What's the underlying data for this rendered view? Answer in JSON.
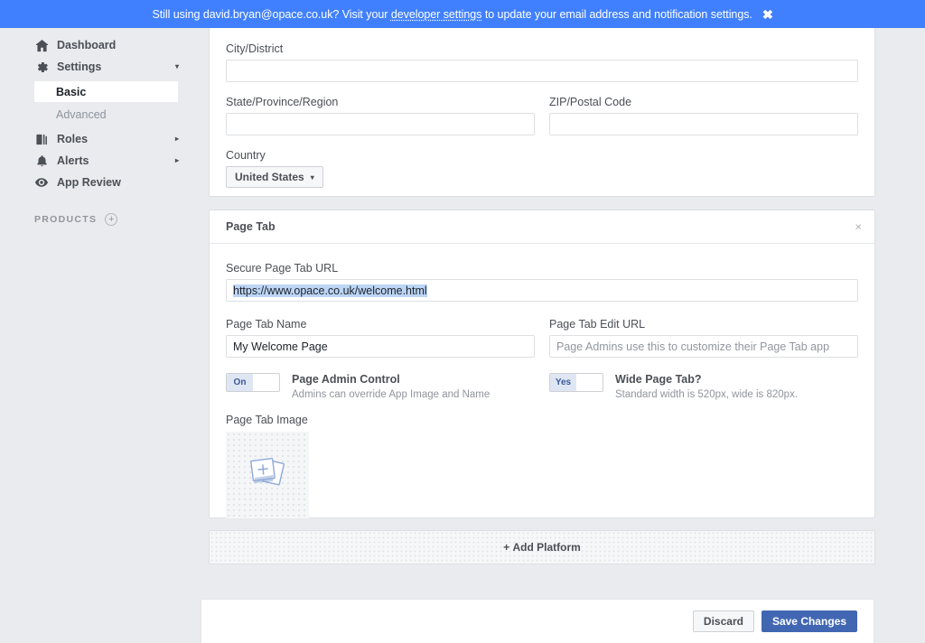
{
  "banner": {
    "text_before": "Still using david.bryan@opace.co.uk? Visit your ",
    "link": "developer settings",
    "text_after": " to update your email address and notification settings.",
    "close_icon": "close-icon",
    "bg_color": "#4080ff"
  },
  "sidebar": {
    "items": [
      {
        "label": "Dashboard",
        "icon": "home-icon",
        "caret": ""
      },
      {
        "label": "Settings",
        "icon": "gear-icon",
        "caret": "▾"
      },
      {
        "label": "Roles",
        "icon": "roles-icon",
        "caret": "▸"
      },
      {
        "label": "Alerts",
        "icon": "bell-icon",
        "caret": "▸"
      },
      {
        "label": "App Review",
        "icon": "eye-icon",
        "caret": ""
      }
    ],
    "settings_sub": [
      {
        "label": "Basic",
        "active": true
      },
      {
        "label": "Advanced",
        "active": false
      }
    ],
    "products_header": "PRODUCTS",
    "products_add_icon": "plus-circle-icon"
  },
  "address_card": {
    "city_label": "City/District",
    "city_value": "",
    "state_label": "State/Province/Region",
    "state_value": "",
    "zip_label": "ZIP/Postal Code",
    "zip_value": "",
    "country_label": "Country",
    "country_value": "United States",
    "country_caret": "▾"
  },
  "page_tab_card": {
    "title": "Page Tab",
    "close_icon": "×",
    "secure_url_label": "Secure Page Tab URL",
    "secure_url_value": "https://www.opace.co.uk/welcome.html",
    "name_label": "Page Tab Name",
    "name_value": "My Welcome Page",
    "edit_url_label": "Page Tab Edit URL",
    "edit_url_value": "",
    "edit_url_placeholder": "Page Admins use this to customize their Page Tab app",
    "admin_toggle_state": "On",
    "admin_toggle_title": "Page Admin Control",
    "admin_toggle_sub": "Admins can override App Image and Name",
    "wide_toggle_state": "Yes",
    "wide_toggle_title": "Wide Page Tab?",
    "wide_toggle_sub": "Standard width is 520px, wide is 820px.",
    "image_label": "Page Tab Image",
    "image_placeholder_icon": "add-photos-icon"
  },
  "add_platform": {
    "icon": "+",
    "label": "Add Platform"
  },
  "savebar": {
    "discard_label": "Discard",
    "save_label": "Save Changes",
    "save_color": "#4267b2"
  }
}
